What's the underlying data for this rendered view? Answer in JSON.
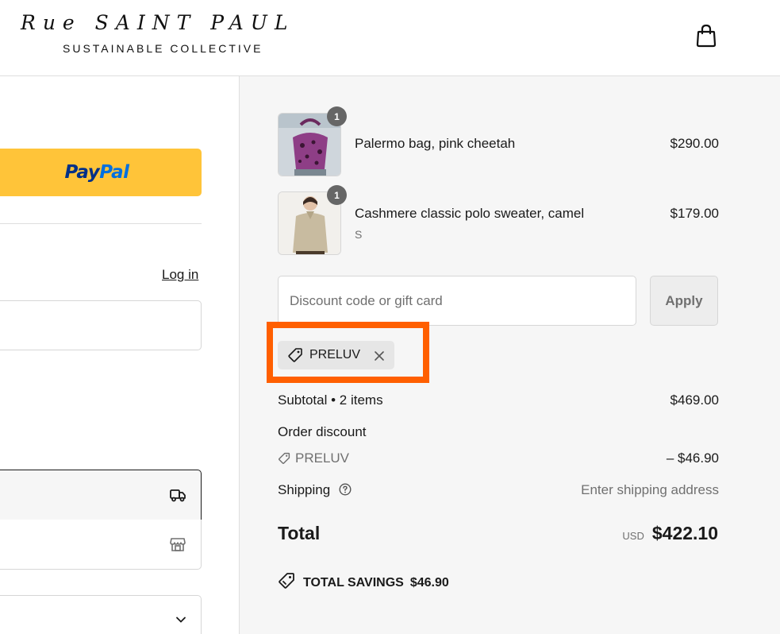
{
  "header": {
    "logo_main": "Rue SAINT PAUL",
    "logo_sub": "SUSTAINABLE COLLECTIVE",
    "cart_icon": "shopping-bag-icon"
  },
  "checkout": {
    "paypal_pay": "Pay",
    "paypal_pal": "Pal",
    "login_label": "Log in",
    "delivery_icon": "truck-icon",
    "pickup_icon": "store-icon",
    "select_icon": "chevron-down-icon"
  },
  "order": {
    "items": [
      {
        "name": "Palermo bag, pink cheetah",
        "variant": "",
        "price": "$290.00",
        "quantity": "1"
      },
      {
        "name": "Cashmere classic polo sweater, camel",
        "variant": "S",
        "price": "$179.00",
        "quantity": "1"
      }
    ],
    "discount": {
      "placeholder": "Discount code or gift card",
      "apply_label": "Apply",
      "applied_code": "PRELUV"
    },
    "subtotal_label": "Subtotal • 2 items",
    "subtotal_value": "$469.00",
    "order_discount_label": "Order discount",
    "discount_code": "PRELUV",
    "discount_value": "– $46.90",
    "shipping_label": "Shipping",
    "shipping_value": "Enter shipping address",
    "total_label": "Total",
    "currency": "USD",
    "total_value": "$422.10",
    "savings_label": "TOTAL SAVINGS",
    "savings_value": "$46.90"
  },
  "colors": {
    "highlight": "#ff5f00",
    "paypal_yellow": "#ffc439",
    "summary_bg": "#f6f6f6"
  }
}
